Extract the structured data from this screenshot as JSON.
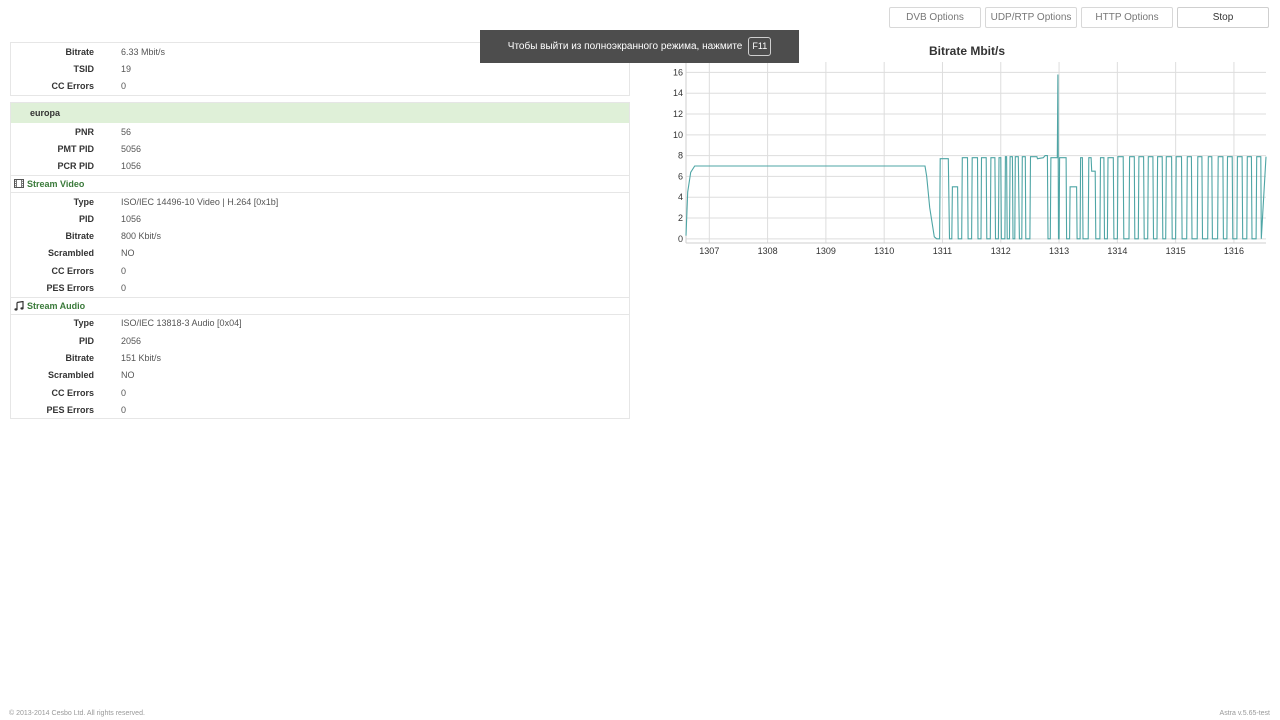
{
  "toolbar": {
    "buttons": [
      {
        "label": "DVB Options"
      },
      {
        "label": "UDP/RTP Options"
      },
      {
        "label": "HTTP Options"
      },
      {
        "label": "Stop"
      }
    ]
  },
  "toast": {
    "message": "Чтобы выйти из полноэкранного режима, нажмите",
    "key": "F11"
  },
  "transport": {
    "rows": [
      {
        "label": "Bitrate",
        "value": "6.33 Mbit/s"
      },
      {
        "label": "TSID",
        "value": "19"
      },
      {
        "label": "CC Errors",
        "value": "0"
      }
    ]
  },
  "program": {
    "name": "europa",
    "rows": [
      {
        "label": "PNR",
        "value": "56"
      },
      {
        "label": "PMT PID",
        "value": "5056"
      },
      {
        "label": "PCR PID",
        "value": "1056"
      }
    ],
    "video": {
      "title": "Stream Video",
      "icon": "film-icon",
      "rows": [
        {
          "label": "Type",
          "value": "ISO/IEC 14496-10 Video | H.264 [0x1b]"
        },
        {
          "label": "PID",
          "value": "1056"
        },
        {
          "label": "Bitrate",
          "value": "800 Kbit/s"
        },
        {
          "label": "Scrambled",
          "value": "NO"
        },
        {
          "label": "CC Errors",
          "value": "0"
        },
        {
          "label": "PES Errors",
          "value": "0"
        }
      ]
    },
    "audio": {
      "title": "Stream Audio",
      "icon": "music-note-icon",
      "rows": [
        {
          "label": "Type",
          "value": "ISO/IEC 13818-3 Audio [0x04]"
        },
        {
          "label": "PID",
          "value": "2056"
        },
        {
          "label": "Bitrate",
          "value": "151 Kbit/s"
        },
        {
          "label": "Scrambled",
          "value": "NO"
        },
        {
          "label": "CC Errors",
          "value": "0"
        },
        {
          "label": "PES Errors",
          "value": "0"
        }
      ]
    }
  },
  "footer": {
    "copyright": "© 2013-2014 Cesbo Ltd. All rights reserved.",
    "version": "Astra v.5.65-test"
  },
  "chart_data": {
    "type": "line",
    "title": "Bitrate Mbit/s",
    "xlim": [
      1306.6,
      1316.55
    ],
    "ylim": [
      -0.4,
      17
    ],
    "xticks": [
      1307,
      1308,
      1309,
      1310,
      1311,
      1312,
      1313,
      1314,
      1315,
      1316
    ],
    "yticks": [
      0,
      2,
      4,
      6,
      8,
      10,
      12,
      14,
      16
    ],
    "grid": true,
    "color": "#4ea5a5",
    "series": [
      {
        "x": [
          1306.6,
          1306.63,
          1306.68,
          1306.75,
          1306.9,
          1310.7,
          1310.73,
          1310.78,
          1310.86,
          1310.9,
          1310.95,
          1310.96,
          1311.1,
          1311.12,
          1311.16,
          1311.17,
          1311.26,
          1311.27,
          1311.33,
          1311.34,
          1311.43,
          1311.44,
          1311.5,
          1311.51,
          1311.6,
          1311.61,
          1311.66,
          1311.67,
          1311.75,
          1311.76,
          1311.82,
          1311.83,
          1311.9,
          1311.91,
          1311.96,
          1311.97,
          1312.0,
          1312.01,
          1312.07,
          1312.08,
          1312.1,
          1312.11,
          1312.15,
          1312.16,
          1312.2,
          1312.21,
          1312.24,
          1312.25,
          1312.3,
          1312.32,
          1312.36,
          1312.37,
          1312.42,
          1312.43,
          1312.5,
          1312.51,
          1312.62,
          1312.63,
          1312.73,
          1312.76,
          1312.8,
          1312.81,
          1312.85,
          1312.86,
          1312.93,
          1312.95,
          1312.97,
          1312.98,
          1312.99,
          1313.0,
          1313.01,
          1313.02,
          1313.12,
          1313.13,
          1313.18,
          1313.19,
          1313.3,
          1313.31,
          1313.36,
          1313.37,
          1313.4,
          1313.41,
          1313.5,
          1313.51,
          1313.55,
          1313.56,
          1313.62,
          1313.63,
          1313.7,
          1313.71,
          1313.77,
          1313.78,
          1313.83,
          1313.84,
          1313.93,
          1313.94,
          1314.0,
          1314.01,
          1314.1,
          1314.11,
          1314.2,
          1314.21,
          1314.29,
          1314.3,
          1314.36,
          1314.37,
          1314.45,
          1314.46,
          1314.52,
          1314.53,
          1314.61,
          1314.62,
          1314.68,
          1314.69,
          1314.77,
          1314.78,
          1314.83,
          1314.84,
          1314.93,
          1314.94,
          1315.0,
          1315.01,
          1315.1,
          1315.11,
          1315.19,
          1315.2,
          1315.27,
          1315.28,
          1315.37,
          1315.38,
          1315.45,
          1315.46,
          1315.55,
          1315.56,
          1315.62,
          1315.63,
          1315.72,
          1315.73,
          1315.81,
          1315.82,
          1315.88,
          1315.89,
          1315.97,
          1315.98,
          1316.05,
          1316.06,
          1316.14,
          1316.15,
          1316.22,
          1316.23,
          1316.3,
          1316.31,
          1316.38,
          1316.39,
          1316.46,
          1316.47,
          1316.55
        ],
        "y": [
          0.3,
          4.5,
          6.4,
          7.0,
          7.0,
          7.0,
          6.0,
          3.0,
          0.2,
          0.0,
          0.0,
          7.7,
          7.7,
          0.0,
          0.0,
          5.0,
          5.0,
          0.0,
          0.0,
          7.8,
          7.8,
          0.0,
          0.0,
          7.8,
          7.8,
          0.0,
          0.0,
          7.8,
          7.8,
          0.0,
          0.0,
          7.8,
          7.8,
          0.0,
          0.0,
          7.8,
          7.8,
          0.0,
          0.0,
          7.9,
          7.9,
          0.0,
          0.0,
          7.9,
          7.9,
          0.0,
          0.0,
          7.9,
          7.9,
          0.0,
          0.0,
          7.9,
          7.9,
          0.0,
          0.0,
          7.9,
          7.9,
          7.7,
          7.8,
          8.0,
          8.0,
          0.0,
          0.0,
          7.8,
          7.8,
          7.8,
          7.8,
          15.8,
          0.0,
          0.0,
          7.8,
          7.8,
          7.8,
          0.0,
          0.0,
          5.0,
          5.0,
          0.0,
          0.0,
          7.8,
          7.8,
          0.0,
          0.0,
          7.8,
          7.8,
          6.5,
          6.5,
          0.0,
          0.0,
          7.8,
          7.8,
          0.0,
          0.0,
          7.8,
          7.8,
          0.0,
          0.0,
          7.9,
          7.9,
          0.0,
          0.0,
          7.9,
          7.9,
          0.0,
          0.0,
          7.9,
          7.9,
          0.0,
          0.0,
          7.9,
          7.9,
          0.0,
          0.0,
          7.9,
          7.9,
          0.0,
          0.0,
          7.9,
          7.9,
          0.0,
          0.0,
          7.9,
          7.9,
          0.0,
          0.0,
          7.9,
          7.9,
          0.0,
          0.0,
          7.9,
          7.9,
          0.0,
          0.0,
          7.9,
          7.9,
          0.0,
          0.0,
          7.9,
          7.9,
          0.0,
          0.0,
          7.9,
          7.9,
          0.0,
          0.0,
          7.9,
          7.9,
          0.0,
          0.0,
          7.9,
          7.9,
          0.0,
          0.0,
          7.9,
          7.9,
          0.0,
          7.9
        ]
      }
    ]
  }
}
